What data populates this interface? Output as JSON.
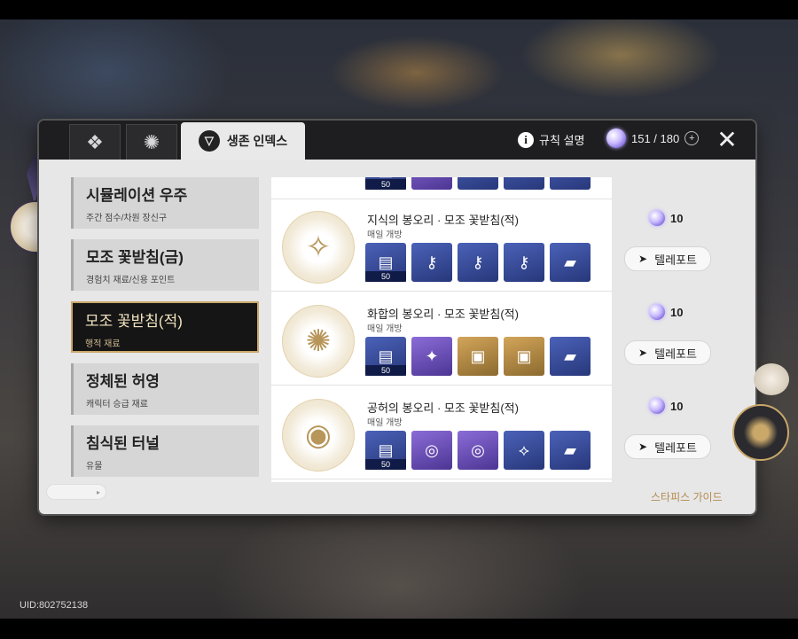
{
  "tabs": {
    "tab1_icon": "grid-emblem-icon",
    "tab2_icon": "compass-emblem-icon",
    "active_label": "생존 인덱스",
    "active_icon": "survival-index-icon"
  },
  "header": {
    "rules_label": "규칙 설명",
    "stamina": "151 / 180",
    "plus": "+",
    "close": "✕"
  },
  "sidebar": {
    "items": [
      {
        "title": "시뮬레이션 우주",
        "subtitle": "주간 점수/차원 장신구"
      },
      {
        "title": "모조 꽃받침(금)",
        "subtitle": "경험치 재료/신용 포인트"
      },
      {
        "title": "모조 꽃받침(적)",
        "subtitle": "행적 재료"
      },
      {
        "title": "정체된 허영",
        "subtitle": "캐릭터 승급 재료"
      },
      {
        "title": "침식된 터널",
        "subtitle": "유물"
      }
    ]
  },
  "list": {
    "top_partial_count": "50",
    "rows": [
      {
        "name": "지식의 봉오리 · 모조 꽃받침(적)",
        "sub": "매일 개방",
        "cost": "10",
        "teleport": "텔레포트",
        "first_count": "50"
      },
      {
        "name": "화합의 봉오리 · 모조 꽃받침(적)",
        "sub": "매일 개방",
        "cost": "10",
        "teleport": "텔레포트",
        "first_count": "50"
      },
      {
        "name": "공허의 봉오리 · 모조 꽃받침(적)",
        "sub": "매일 개방",
        "cost": "10",
        "teleport": "텔레포트",
        "first_count": "50"
      }
    ]
  },
  "footer": {
    "guide": "스타피스 가이드",
    "uid": "UID:802752138"
  }
}
